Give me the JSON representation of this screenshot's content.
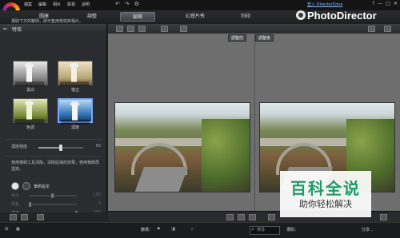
{
  "app": {
    "menu": [
      "檔案",
      "編輯",
      "相片",
      "檢視",
      "說明"
    ],
    "login_link": "登入 DirectorZone",
    "brand": "PhotoDirector",
    "window_controls": [
      "?",
      "—",
      "□",
      "✕"
    ]
  },
  "mode_tabs": [
    {
      "label": "圖庫",
      "active": false
    },
    {
      "label": "調整",
      "active": false
    },
    {
      "label": "編輯",
      "active": true
    },
    {
      "label": "幻燈片秀",
      "active": false
    },
    {
      "label": "列印",
      "active": false
    }
  ],
  "left_panel": {
    "header": "特效",
    "note": "選取下方的範例，即可套用特效到相片。",
    "presets": [
      {
        "label": "黑白",
        "selected": false
      },
      {
        "label": "復古",
        "selected": false
      },
      {
        "label": "色調",
        "selected": false
      },
      {
        "label": "濃度",
        "selected": true
      }
    ],
    "strength_label": "濃度強度",
    "strength_value": "50",
    "brush_hint": "使用筆刷工具清除，清除區域的效果，使用筆刷再塗抹。",
    "brush_label": "筆刷設定",
    "brush_sliders": [
      {
        "label": "大小",
        "value": "100"
      },
      {
        "label": "羽化",
        "value": "0"
      },
      {
        "label": "濃度",
        "value": "100"
      }
    ],
    "auto_mask_label": "自動遮罩"
  },
  "viewer": {
    "compare_before": "調整前",
    "compare_after": "調整後"
  },
  "status_bar": {
    "label_filter": "篩選：",
    "search_placeholder": "搜尋",
    "select_label": "選取：",
    "share_label": "分享..."
  },
  "watermark": {
    "title": "百科全说",
    "subtitle": "助你轻松解决"
  }
}
